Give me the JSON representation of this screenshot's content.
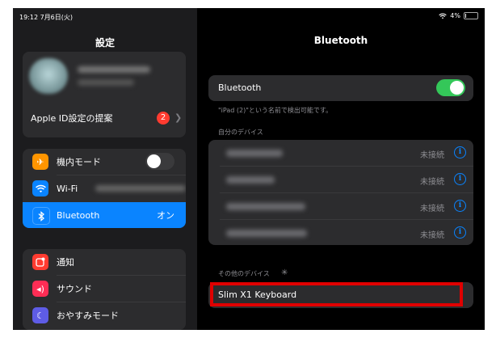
{
  "status": {
    "time": "19:12  7月6日(火)",
    "battery": "4%"
  },
  "sidebar": {
    "title": "設定",
    "apple_id_suggestion": "Apple ID設定の提案",
    "apple_id_badge": "2",
    "items": [
      {
        "label": "機内モード",
        "icon": "airplane-icon",
        "color": "#ff9500"
      },
      {
        "label": "Wi-Fi",
        "icon": "wifi-icon",
        "color": "#0a84ff"
      },
      {
        "label": "Bluetooth",
        "icon": "bluetooth-icon",
        "color": "#0a84ff",
        "value": "オン"
      }
    ],
    "items2": [
      {
        "label": "通知",
        "icon": "notification-icon",
        "color": "#ff3b30"
      },
      {
        "label": "サウンド",
        "icon": "sound-icon",
        "color": "#ff2d55"
      },
      {
        "label": "おやすみモード",
        "icon": "moon-icon",
        "color": "#5e5ce6"
      }
    ]
  },
  "main": {
    "title": "Bluetooth",
    "bluetooth_label": "Bluetooth",
    "bluetooth_on": true,
    "discoverable_note": "\"iPad (2)\"という名前で検出可能です。",
    "my_devices_header": "自分のデバイス",
    "my_devices_status": [
      "未接続",
      "未接続",
      "未接続",
      "未接続"
    ],
    "other_devices_header": "その他のデバイス",
    "other_device": "Slim X1 Keyboard"
  },
  "colors": {
    "accent": "#0a84ff",
    "toggle_on": "#34c759",
    "highlight_box": "#e00000"
  }
}
